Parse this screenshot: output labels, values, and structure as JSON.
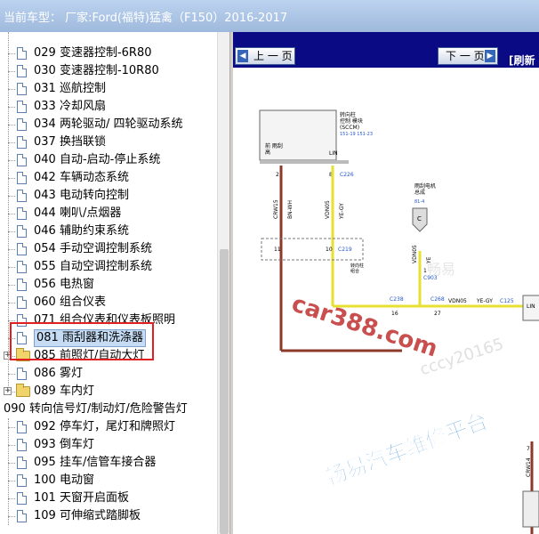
{
  "header": {
    "title": "当前车型：   厂家:Ford(福特)猛禽（F150）2016-2017"
  },
  "tree": {
    "items": [
      {
        "label": "029 变速器控制-6R80",
        "type": "doc"
      },
      {
        "label": "030 变速器控制-10R80",
        "type": "doc"
      },
      {
        "label": "031 巡航控制",
        "type": "doc"
      },
      {
        "label": "033 冷却风扇",
        "type": "doc"
      },
      {
        "label": "034 两轮驱动/ 四轮驱动系统",
        "type": "doc"
      },
      {
        "label": "037 换挡联锁",
        "type": "doc"
      },
      {
        "label": "040 自动-启动-停止系统",
        "type": "doc"
      },
      {
        "label": "042 车辆动态系统",
        "type": "doc"
      },
      {
        "label": "043 电动转向控制",
        "type": "doc"
      },
      {
        "label": "044 喇叭/点烟器",
        "type": "doc"
      },
      {
        "label": "046 辅助约束系统",
        "type": "doc"
      },
      {
        "label": "054 手动空调控制系统",
        "type": "doc"
      },
      {
        "label": "055 自动空调控制系统",
        "type": "doc"
      },
      {
        "label": "056 电热窗",
        "type": "doc"
      },
      {
        "label": "060 组合仪表",
        "type": "doc"
      },
      {
        "label": "071 组合仪表和仪表板照明",
        "type": "doc"
      },
      {
        "label": "081 雨刮器和洗涤器",
        "type": "doc",
        "selected": true
      },
      {
        "label": "085 前照灯/自动大灯",
        "type": "folder",
        "expander": "+"
      },
      {
        "label": "086 雾灯",
        "type": "doc"
      },
      {
        "label": "089 车内灯",
        "type": "folder",
        "expander": "+"
      },
      {
        "label": "090 转向信号灯/制动灯/危险警告灯",
        "type": "root"
      },
      {
        "label": "092 停车灯，尾灯和牌照灯",
        "type": "doc"
      },
      {
        "label": "093 倒车灯",
        "type": "doc"
      },
      {
        "label": "095 挂车/信管车接合器",
        "type": "doc"
      },
      {
        "label": "100 电动窗",
        "type": "doc"
      },
      {
        "label": "101 天窗开启面板",
        "type": "doc"
      },
      {
        "label": "109 可伸缩式踏脚板",
        "type": "doc"
      }
    ]
  },
  "nav": {
    "prev_label": "上 一 页",
    "next_label": "下 一 页",
    "refresh_label": "[刷新"
  },
  "diagram": {
    "module_name": "转向柱\n控制 模块\n(SCCM)",
    "module_code": "151-19  151-23",
    "pin_left_label": "前 雨刮\n高",
    "pin_right_label": "LIN",
    "pin2": "2",
    "pin8": "8",
    "conn_c226": "C226",
    "wire1_code": "CRW15",
    "wire1_color": "BN-WH",
    "wire2_code": "VDN05",
    "wire2_color": "YE-GY",
    "pin11": "11",
    "pin10": "10",
    "conn_c219": "C219",
    "inline_label": "转向柱\n组合",
    "wiper_motor_label": "雨刮电机\n总成",
    "ref_814": "81-4",
    "c_label": "C",
    "pin1": "1",
    "conn_c903": "C903",
    "wire3_code": "VDN05",
    "wire3_color": "YE",
    "conn_c238": "C238",
    "pin16": "16",
    "conn_c268": "C268",
    "pin27": "27",
    "wire4_code": "VDN05",
    "wire4_color": "YE-GY",
    "conn_c125": "C125",
    "pin_lin": "LIN",
    "wire5_code": "CRW14",
    "pin7": "7",
    "watermark1": "car388.com",
    "watermark2": "畅易汽车维修平台",
    "watermark3": "cccy20165",
    "watermark4": "畅易"
  },
  "colors": {
    "titlebar": "#a9c1e3",
    "topbar": "#0a0a84",
    "wire_yellow": "#e8e030",
    "wire_brown": "#8b3a2a",
    "highlight_box": "#e02020"
  }
}
